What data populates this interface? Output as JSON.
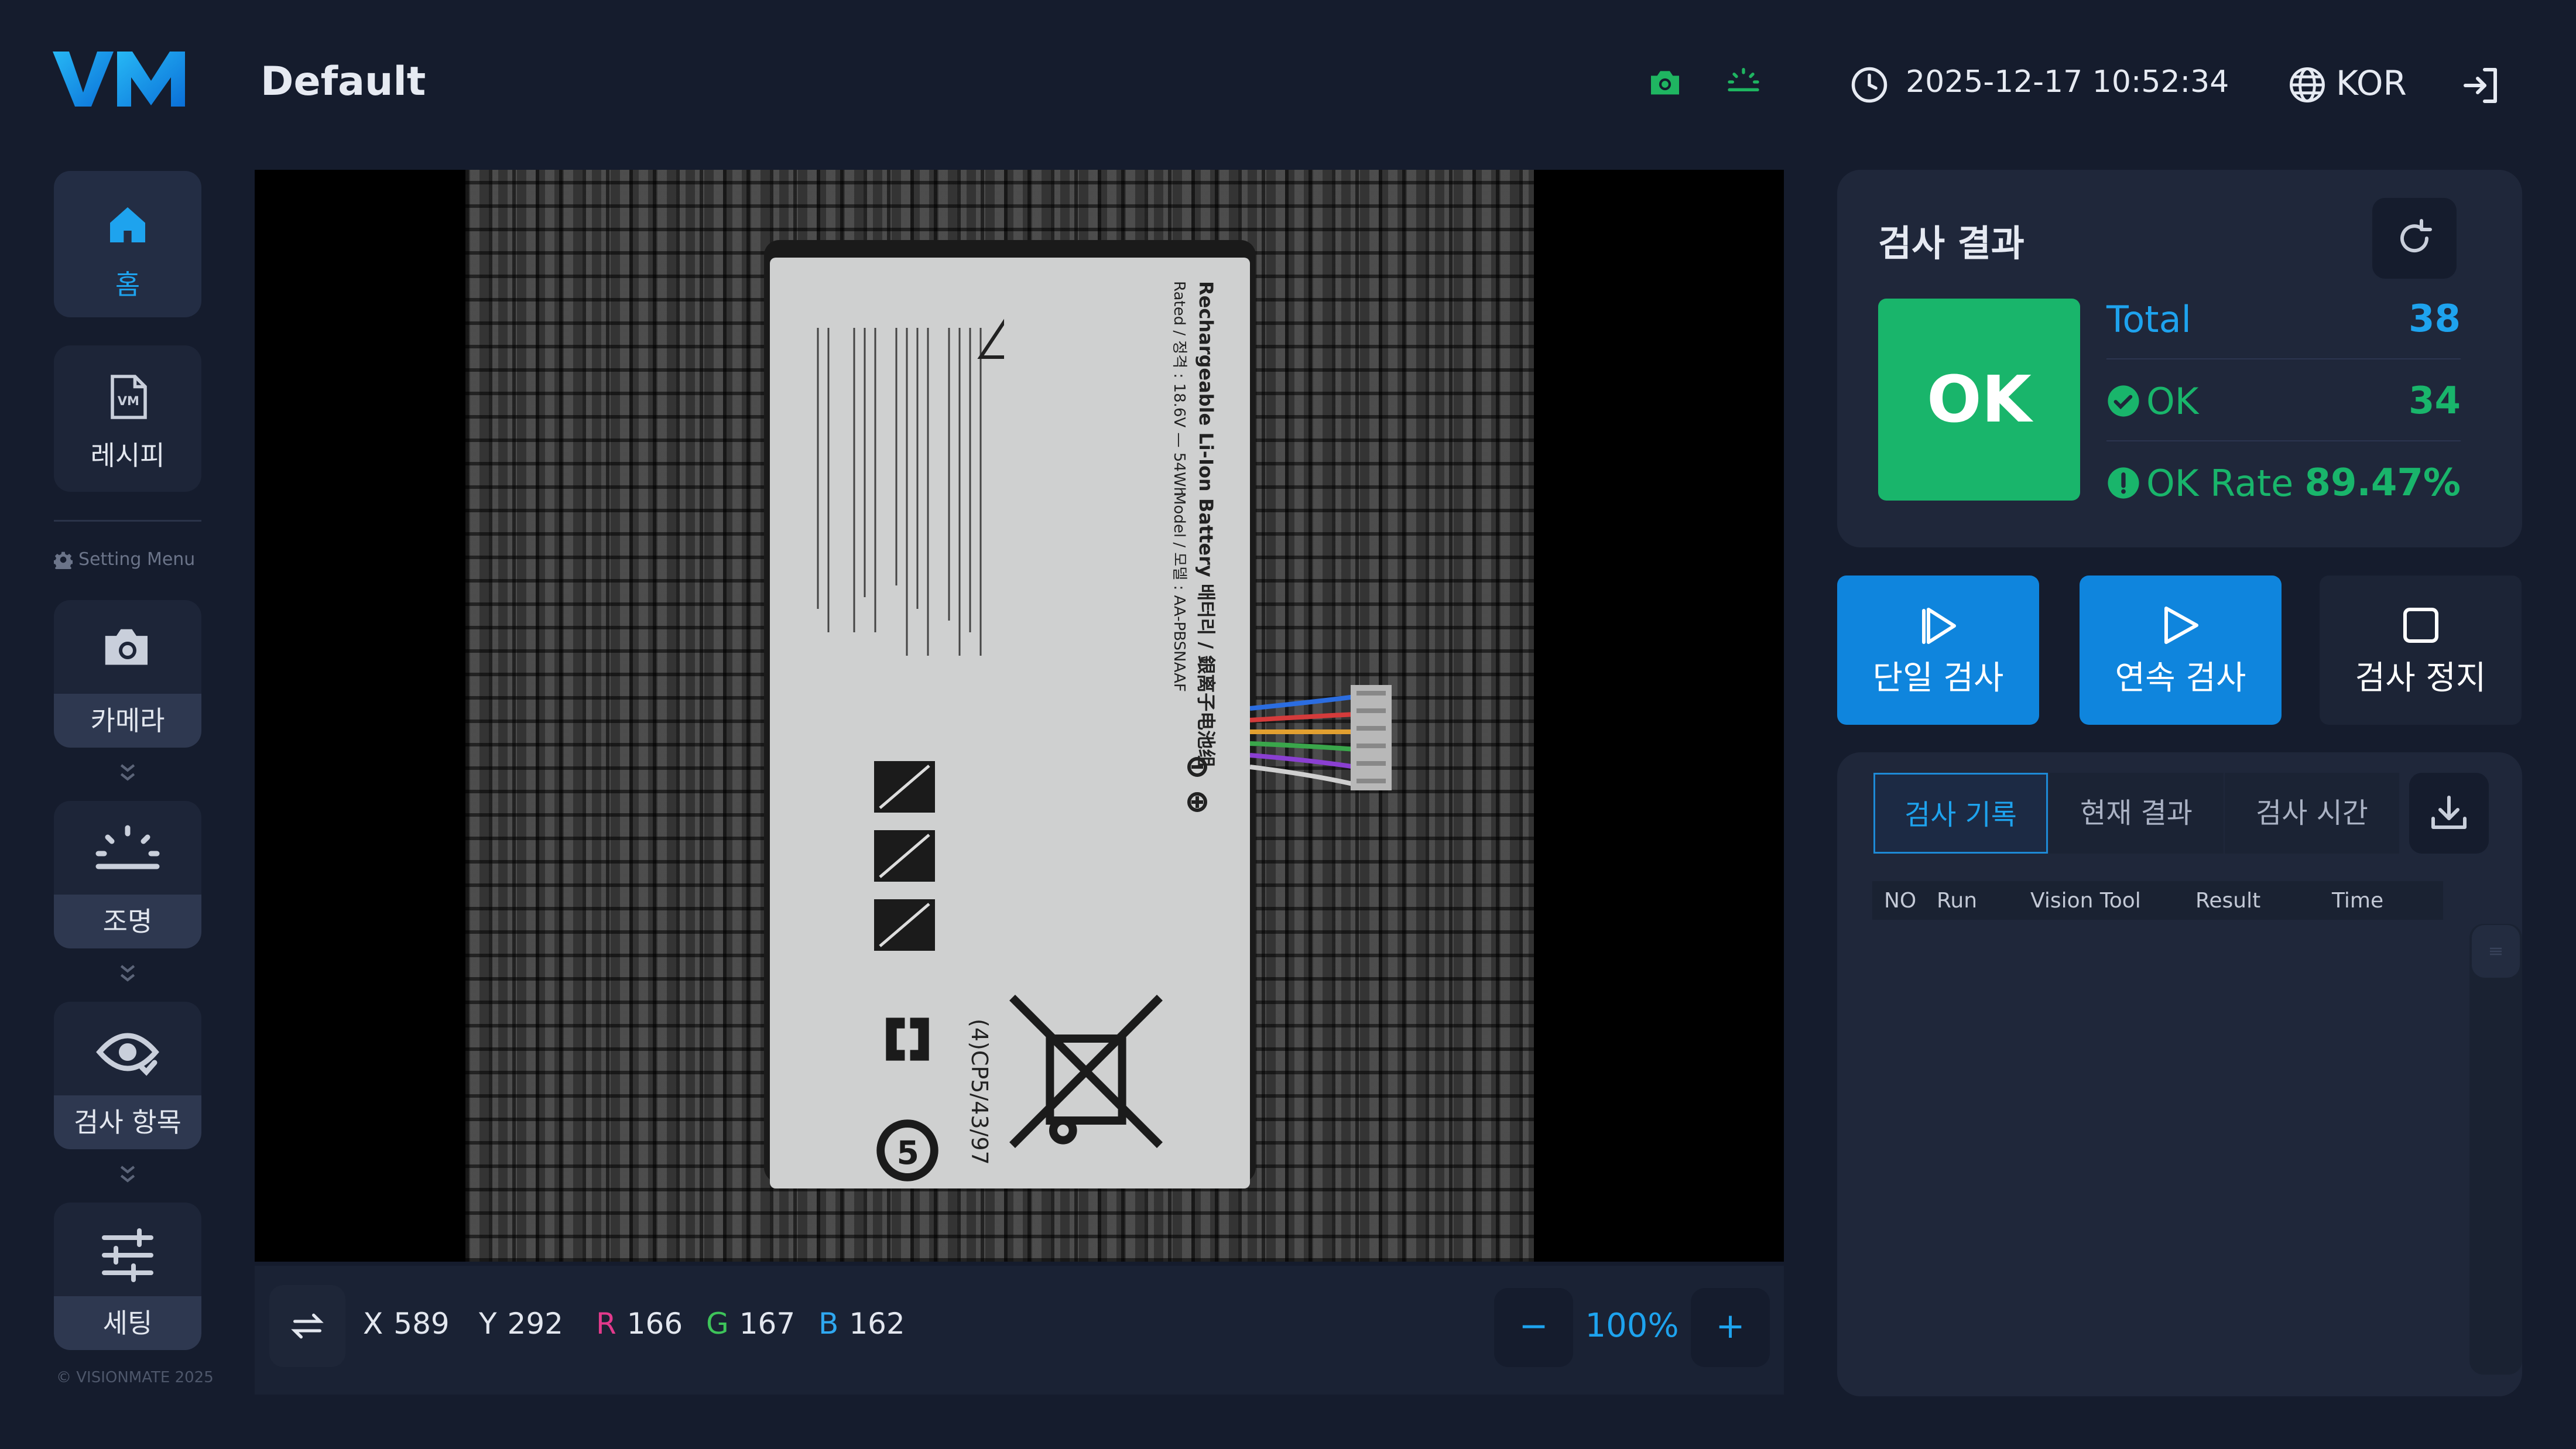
{
  "app": {
    "title": "Default",
    "datetime": "2025-12-17 10:52:34",
    "language": "KOR",
    "copyright": "© VISIONMATE 2025"
  },
  "sidebar": {
    "home_label": "홈",
    "recipe_label": "레시피",
    "setting_menu_label": "Setting Menu",
    "items": [
      {
        "label": "카메라",
        "icon": "camera-icon"
      },
      {
        "label": "조명",
        "icon": "light-icon"
      },
      {
        "label": "검사 항목",
        "icon": "eye-icon"
      },
      {
        "label": "세팅",
        "icon": "sliders-icon"
      }
    ]
  },
  "viewer": {
    "battery_text": {
      "line1": "Rechargeable Li-Ion Battery 배터리 / 銀离子电池组",
      "line2": "Model / 모델 : AA-PBSNAAF",
      "line3": "Rated / 정격 : 18.6V — 54Wh",
      "model_code": "(4)CP5/43/97"
    },
    "coords": {
      "x_label": "X",
      "x": "589",
      "y_label": "Y",
      "y": "292",
      "r_label": "R",
      "r": "166",
      "g_label": "G",
      "g": "167",
      "b_label": "B",
      "b": "162"
    },
    "zoom": "100%",
    "zoom_minus": "−",
    "zoom_plus": "+"
  },
  "result": {
    "title": "검사 결과",
    "status": "OK",
    "total_label": "Total",
    "total_value": "38",
    "ok_label": "OK",
    "ok_value": "34",
    "rate_label": "OK Rate",
    "rate_value": "89.47%"
  },
  "actions": {
    "single": "단일 검사",
    "continuous": "연속 검사",
    "stop": "검사 정지"
  },
  "history": {
    "tabs": [
      "검사 기록",
      "현재 결과",
      "검사 시간"
    ],
    "columns": [
      "NO",
      "Run",
      "Vision Tool",
      "Result",
      "Time"
    ]
  },
  "colors": {
    "accent": "#1ea3ee",
    "ok_green": "#19b56b",
    "bg": "#151c2d",
    "status_green": "#1fb561"
  }
}
